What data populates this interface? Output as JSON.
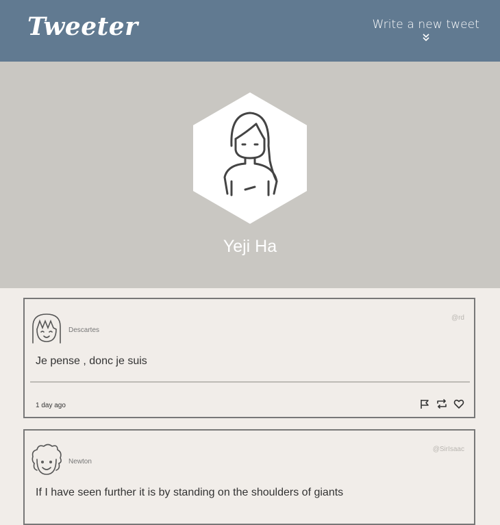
{
  "nav": {
    "logo": "Tweeter",
    "compose_label": "Write a new tweet",
    "compose_icon": "chevron-double-down-icon"
  },
  "profile": {
    "name": "Yeji Ha",
    "avatar_icon": "girl-avatar-icon"
  },
  "tweets": [
    {
      "name": "Descartes",
      "handle": "@rd",
      "content": "Je pense , donc je suis",
      "time": "1 day ago",
      "avatar_icon": "descartes-avatar-icon",
      "actions": [
        "flag-icon",
        "retweet-icon",
        "heart-icon"
      ]
    },
    {
      "name": "Newton",
      "handle": "@SirIsaac",
      "content": "If I have seen further it is by standing on the shoulders of giants",
      "avatar_icon": "newton-avatar-icon"
    }
  ],
  "colors": {
    "nav_bg": "#617a91",
    "banner_bg": "#c9c7c2",
    "page_bg": "#f1ede9",
    "card_border": "#777777"
  }
}
